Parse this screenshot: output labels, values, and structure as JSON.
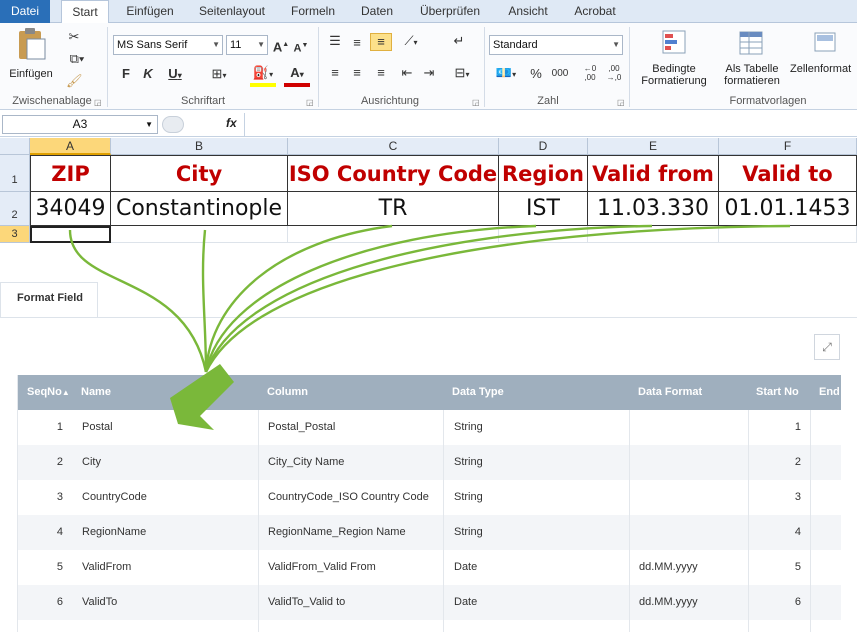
{
  "ribbon": {
    "tabs": [
      "Datei",
      "Start",
      "Einfügen",
      "Seitenlayout",
      "Formeln",
      "Daten",
      "Überprüfen",
      "Ansicht",
      "Acrobat"
    ],
    "paste_label": "Einfügen",
    "font_name": "MS Sans Serif",
    "font_size": "11",
    "number_format": "Standard",
    "cond_format_line1": "Bedingte",
    "cond_format_line2": "Formatierung",
    "as_table_line1": "Als Tabelle",
    "as_table_line2": "formatieren",
    "cell_styles_label": "Zellenformat",
    "groups": [
      "Zwischenablage",
      "Schriftart",
      "Ausrichtung",
      "Zahl",
      "Formatvorlagen"
    ],
    "accent_color": "#2a6fb8"
  },
  "formula_bar": {
    "name_box": "A3",
    "fx_label": "fx",
    "formula": ""
  },
  "sheet": {
    "columns": [
      "A",
      "B",
      "C",
      "D",
      "E",
      "F"
    ],
    "rows": [
      "1",
      "2",
      "3"
    ],
    "headers": [
      "ZIP",
      "City",
      "ISO Country Code",
      "Region",
      "Valid from",
      "Valid to"
    ],
    "values": [
      "34049",
      "Constantinople",
      "TR",
      "IST",
      "11.03.330",
      "01.01.1453"
    ],
    "header_color": "#c00000",
    "arrow_color": "#7ab83a"
  },
  "format_field": {
    "tab_label": "Format Field",
    "columns": [
      "SeqNo",
      "Name",
      "Column",
      "Data Type",
      "Data Format",
      "Start No",
      "End"
    ],
    "rows": [
      {
        "seq": "1",
        "name": "Postal",
        "column": "Postal_Postal",
        "type": "String",
        "format": "",
        "start": "1"
      },
      {
        "seq": "2",
        "name": "City",
        "column": "City_City Name",
        "type": "String",
        "format": "",
        "start": "2"
      },
      {
        "seq": "3",
        "name": "CountryCode",
        "column": "CountryCode_ISO Country Code",
        "type": "String",
        "format": "",
        "start": "3"
      },
      {
        "seq": "4",
        "name": "RegionName",
        "column": "RegionName_Region Name",
        "type": "String",
        "format": "",
        "start": "4"
      },
      {
        "seq": "5",
        "name": "ValidFrom",
        "column": "ValidFrom_Valid From",
        "type": "Date",
        "format": "dd.MM.yyyy",
        "start": "5"
      },
      {
        "seq": "6",
        "name": "ValidTo",
        "column": "ValidTo_Valid to",
        "type": "Date",
        "format": "dd.MM.yyyy",
        "start": "6"
      }
    ],
    "header_color": "#9fafbe",
    "sort_icon": "sort-ascending-icon",
    "expand_icon": "expand-icon"
  }
}
